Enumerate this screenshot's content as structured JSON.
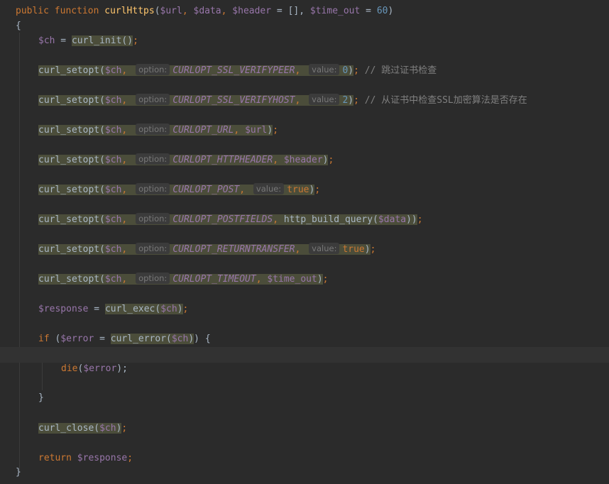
{
  "code": {
    "line1": {
      "kw_public": "public",
      "kw_function": "function",
      "name": "curlHttps",
      "open": "(",
      "p1": "$url",
      "sep1": ", ",
      "p2": "$data",
      "sep2": ", ",
      "p3": "$header",
      "eq3": " = [], ",
      "p4": "$time_out",
      "eq4": " = ",
      "p4_default": "60",
      "close": ")"
    },
    "open_brace": "{",
    "close_brace": "}",
    "init": {
      "var": "$ch",
      "eq": " = ",
      "call": "curl_init()",
      "semi": ";"
    },
    "setopt_fn": "curl_setopt(",
    "ch_arg": "$ch",
    "comma": ", ",
    "option_hint": "option:",
    "value_hint": "value:",
    "setopts": [
      {
        "const": "CURLOPT_SSL_VERIFYPEER",
        "sep": ", ",
        "has_value_hint": true,
        "value": "0",
        "value_class": "num",
        "tail": ");",
        "comment": " // 跳过证书检查"
      },
      {
        "const": "CURLOPT_SSL_VERIFYHOST",
        "sep": ", ",
        "has_value_hint": true,
        "value": "2",
        "value_class": "num",
        "tail": ");",
        "comment": " // 从证书中检查SSL加密算法是否存在"
      },
      {
        "const": "CURLOPT_URL",
        "sep": ", ",
        "has_value_hint": false,
        "value": "$url",
        "value_class": "var",
        "tail": ");",
        "comment": ""
      },
      {
        "const": "CURLOPT_HTTPHEADER",
        "sep": ", ",
        "has_value_hint": false,
        "value": "$header",
        "value_class": "var",
        "tail": ");",
        "comment": ""
      },
      {
        "const": "CURLOPT_POST",
        "sep": ", ",
        "has_value_hint": true,
        "value": "true",
        "value_class": "kw",
        "tail": ");",
        "comment": ""
      },
      {
        "const": "CURLOPT_POSTFIELDS",
        "sep": ", ",
        "has_value_hint": false,
        "value": "http_build_query($data)",
        "value_class": "mixed",
        "tail": ");",
        "comment": ""
      },
      {
        "const": "CURLOPT_RETURNTRANSFER",
        "sep": ", ",
        "has_value_hint": true,
        "value": "true",
        "value_class": "kw",
        "tail": ");",
        "comment": ""
      },
      {
        "const": "CURLOPT_TIMEOUT",
        "sep": ", ",
        "has_value_hint": false,
        "value": "$time_out",
        "value_class": "var",
        "tail": ");",
        "comment": ""
      }
    ],
    "exec": {
      "var": "$response",
      "eq": " = ",
      "fn": "curl_exec(",
      "arg": "$ch",
      "close": ")",
      "semi": ";"
    },
    "if_line": {
      "kw": "if",
      "open": " (",
      "var": "$error",
      "eq": " = ",
      "fn": "curl_error(",
      "arg": "$ch",
      "close": ")",
      "rest": ") {"
    },
    "die_line": {
      "fn": "die",
      "open": "(",
      "var": "$error",
      "close": ");"
    },
    "inner_close": "}",
    "close_line": {
      "fn": "curl_close(",
      "arg": "$ch",
      "close": ")",
      "semi": ";"
    },
    "return_line": {
      "kw": "return",
      "space": " ",
      "var": "$response",
      "semi": ";"
    },
    "postfields": {
      "fn": "http_build_query(",
      "arg": "$data",
      "close": ")"
    }
  }
}
